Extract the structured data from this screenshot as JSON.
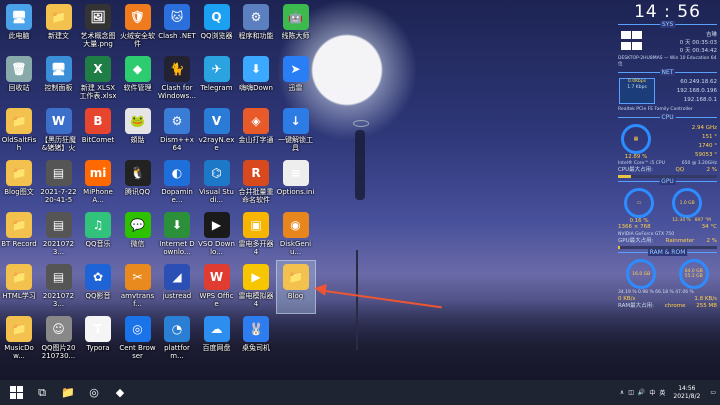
{
  "desktop": {
    "icons": [
      {
        "label": "此电脑",
        "icon": "computer-icon",
        "color": "#4aa3e8",
        "glyph": "🖥"
      },
      {
        "label": "新建文",
        "icon": "folder-icon",
        "color": "#f2c14e",
        "glyph": "📁"
      },
      {
        "label": "艺术概念图大量.png",
        "icon": "image-icon",
        "color": "#333",
        "glyph": "🖼"
      },
      {
        "label": "火绒安全软件",
        "icon": "huorong-icon",
        "color": "#f07a1e",
        "glyph": "🛡"
      },
      {
        "label": "Clash .NET",
        "icon": "cat-icon",
        "color": "#2a6fdb",
        "glyph": "🐱"
      },
      {
        "label": "QQ浏览器",
        "icon": "qq-browser-icon",
        "color": "#1ca0f2",
        "glyph": "Q"
      },
      {
        "label": "程序和功能",
        "icon": "programs-icon",
        "color": "#5b7fbf",
        "glyph": "⚙"
      },
      {
        "label": "线陈大师",
        "icon": "android-icon",
        "color": "#3dba4e",
        "glyph": "🤖"
      },
      {
        "label": "回收站",
        "icon": "recycle-bin-icon",
        "color": "#8aa",
        "glyph": "🗑"
      },
      {
        "label": "控制面板",
        "icon": "control-panel-icon",
        "color": "#3a8fd8",
        "glyph": "🖥"
      },
      {
        "label": "新建 XLSX 工作表.xlsx",
        "icon": "excel-icon",
        "color": "#1e7e45",
        "glyph": "X"
      },
      {
        "label": "软件管理",
        "icon": "software-manager-icon",
        "color": "#2ecc71",
        "glyph": "◆"
      },
      {
        "label": "Clash for Windows...",
        "icon": "clash-icon",
        "color": "#223",
        "glyph": "🐈"
      },
      {
        "label": "Telegram",
        "icon": "telegram-icon",
        "color": "#2aa3e0",
        "glyph": "✈"
      },
      {
        "label": "嗨嗨Down",
        "icon": "down-icon",
        "color": "#3ba9ff",
        "glyph": "⬇"
      },
      {
        "label": "迅雷",
        "icon": "xunlei-icon",
        "color": "#2a7ef5",
        "glyph": "➤"
      },
      {
        "label": "OldSaltFish",
        "icon": "folder-icon",
        "color": "#f2c14e",
        "glyph": "📁"
      },
      {
        "label": "【黑历狂魔&猪猪】火影...",
        "icon": "doc-icon",
        "color": "#3b6fc9",
        "glyph": "W"
      },
      {
        "label": "BitComet",
        "icon": "bitcomet-icon",
        "color": "#e8452f",
        "glyph": "B"
      },
      {
        "label": "頞骷",
        "icon": "frog-icon",
        "color": "#e5e5e5",
        "glyph": "🐸"
      },
      {
        "label": "Dism++x64",
        "icon": "dism-icon",
        "color": "#3a7bd5",
        "glyph": "⚙"
      },
      {
        "label": "v2rayN.exe",
        "icon": "v2ray-icon",
        "color": "#2a7bd5",
        "glyph": "V"
      },
      {
        "label": "金山打字通",
        "icon": "typing-icon",
        "color": "#e85a2a",
        "glyph": "◈"
      },
      {
        "label": "一键解锁工具",
        "icon": "unlock-tool-icon",
        "color": "#2d7be5",
        "glyph": "↓"
      },
      {
        "label": "Blog图文",
        "icon": "folder-icon",
        "color": "#f2c14e",
        "glyph": "📁"
      },
      {
        "label": "2021-7-22 20-41-55...",
        "icon": "image-file-icon",
        "color": "#555",
        "glyph": "▤"
      },
      {
        "label": "MiPhoneA...",
        "icon": "mi-icon",
        "color": "#ff6900",
        "glyph": "mi"
      },
      {
        "label": "腾讯QQ",
        "icon": "qq-icon",
        "color": "#222",
        "glyph": "🐧"
      },
      {
        "label": "Dopamine...",
        "icon": "dopamine-icon",
        "color": "#1e6fd9",
        "glyph": "◐"
      },
      {
        "label": "Visual Studi...",
        "icon": "vscode-icon",
        "color": "#1e78c8",
        "glyph": "⌬"
      },
      {
        "label": "合并批量重命名软件",
        "icon": "rename-icon",
        "color": "#d84a1e",
        "glyph": "R"
      },
      {
        "label": "Options.ini",
        "icon": "ini-file-icon",
        "color": "#eee",
        "glyph": "≡"
      },
      {
        "label": "BT Record",
        "icon": "folder-icon",
        "color": "#f2c14e",
        "glyph": "📁"
      },
      {
        "label": "20210723...",
        "icon": "image-file-icon",
        "color": "#555",
        "glyph": "▤"
      },
      {
        "label": "QQ音乐",
        "icon": "qq-music-icon",
        "color": "#31c27c",
        "glyph": "♫"
      },
      {
        "label": "微信",
        "icon": "wechat-icon",
        "color": "#2dc100",
        "glyph": "💬"
      },
      {
        "label": "Internet Downlo...",
        "icon": "idm-icon",
        "color": "#2c8f3a",
        "glyph": "⬇"
      },
      {
        "label": "VSO Downlo...",
        "icon": "vso-icon",
        "color": "#1a1a1a",
        "glyph": "▶"
      },
      {
        "label": "雷电多开器4",
        "icon": "ldplayer-multi-icon",
        "color": "#f7b500",
        "glyph": "▣"
      },
      {
        "label": "DiskGeniu...",
        "icon": "diskgenius-icon",
        "color": "#e8861e",
        "glyph": "◉"
      },
      {
        "label": "HTML学习",
        "icon": "folder-icon",
        "color": "#f2c14e",
        "glyph": "📁"
      },
      {
        "label": "20210723...",
        "icon": "image-file-icon",
        "color": "#555",
        "glyph": "▤"
      },
      {
        "label": "QQ影音",
        "icon": "qq-player-icon",
        "color": "#1f64d6",
        "glyph": "✿"
      },
      {
        "label": "amvtransf...",
        "icon": "amv-icon",
        "color": "#e88a1e",
        "glyph": "✂"
      },
      {
        "label": "justread",
        "icon": "justread-icon",
        "color": "#2b4fb5",
        "glyph": "◢"
      },
      {
        "label": "WPS Office",
        "icon": "wps-icon",
        "color": "#e03c31",
        "glyph": "W"
      },
      {
        "label": "雷电模拟器4",
        "icon": "ldplayer-icon",
        "color": "#f7c600",
        "glyph": "▶"
      },
      {
        "label": "Blog",
        "icon": "folder-icon",
        "color": "#f2c14e",
        "glyph": "📁",
        "selected": true
      },
      {
        "label": "MusicDow...",
        "icon": "folder-icon",
        "color": "#f2c14e",
        "glyph": "📁"
      },
      {
        "label": "QQ图片20210730...",
        "icon": "photo-icon",
        "color": "#888",
        "glyph": "☺"
      },
      {
        "label": "Typora",
        "icon": "typora-icon",
        "color": "#f5f5f5",
        "glyph": "T"
      },
      {
        "label": "Cent Browser",
        "icon": "cent-browser-icon",
        "color": "#1a73e8",
        "glyph": "◎"
      },
      {
        "label": "plattform...",
        "icon": "platform-icon",
        "color": "#2a7fd5",
        "glyph": "◔"
      },
      {
        "label": "百度网盘",
        "icon": "baidu-pan-icon",
        "color": "#2e8ef0",
        "glyph": "☁"
      },
      {
        "label": "桌兔司机",
        "icon": "rabbit-icon",
        "color": "#2e7df0",
        "glyph": "🐰"
      }
    ]
  },
  "panel": {
    "clock": "14 : 56",
    "sys_title": "SYS",
    "sys_user": "吉琳",
    "sys_uptime1": "0 天 00:35:03",
    "sys_uptime2": "0 天 00:34:42",
    "sys_os": "DESKTOP-2HU8MAS — Win 10 Education 64 位",
    "net_title": "NET",
    "net_down": "0.0Kbps",
    "net_up": "1.7 Kbps",
    "net_ip1": "60.249.18.62",
    "net_ip2": "192.168.0.196",
    "net_ip3": "192.168.0.1",
    "net_adapter": "Realtek PCIe FE Family Controller",
    "cpu_title": "CPU",
    "cpu_freq": "2.94 GHz",
    "cpu_temp": "151 °",
    "cpu_rpm": "1740 °",
    "cpu_procs": "59053 °",
    "cpu_usage": "12.89 %",
    "cpu_name": "Intel® Core™ i5 CPU",
    "cpu_model": "650 @ 3.20GHz",
    "cpu_top_label": "CPU最大占用:",
    "cpu_top_value": "QQ",
    "cpu_top_pct": "2 %",
    "gpu_title": "GPU",
    "gpu_usage": "0.16 %",
    "gpu_mem": "1.0 GB",
    "gpu_mem_pct": "12.34 %",
    "gpu_clock": "897 °M",
    "gpu_res": "1366 × 768",
    "gpu_temp": "34 °C",
    "gpu_name": "NVIDIA GeForce GTX 750",
    "gpu_top_label": "GPU最大占用:",
    "gpu_top_value": "Rainmeter",
    "gpu_top_pct": "2 %",
    "ram_title": "RAM & ROM",
    "ram_total": "16.0 GB",
    "rom_total": "64.0 GB",
    "rom_used": "55.2 GB",
    "ram_stats": "34.19 %  0.98 %  66.18 %  47.06 %",
    "ram_net": "0 KB/s",
    "ram_net2": "1.8 KB/s",
    "ram_top_label": "RAM最大占用:",
    "ram_top_value": "chrome",
    "ram_top_size": "255 MB",
    "cpu_usage_frac": 0.13,
    "gpu_usage_frac": 0.02
  },
  "taskbar": {
    "start": "start-icon",
    "apps": [
      {
        "name": "taskbar-task-view",
        "glyph": "⧉"
      },
      {
        "name": "taskbar-explorer",
        "glyph": "📁"
      },
      {
        "name": "taskbar-browser",
        "glyph": "◎"
      },
      {
        "name": "taskbar-app",
        "glyph": "◆"
      }
    ],
    "time": "14:56",
    "date": "2021/8/2",
    "ime": "中",
    "lang": "英"
  }
}
